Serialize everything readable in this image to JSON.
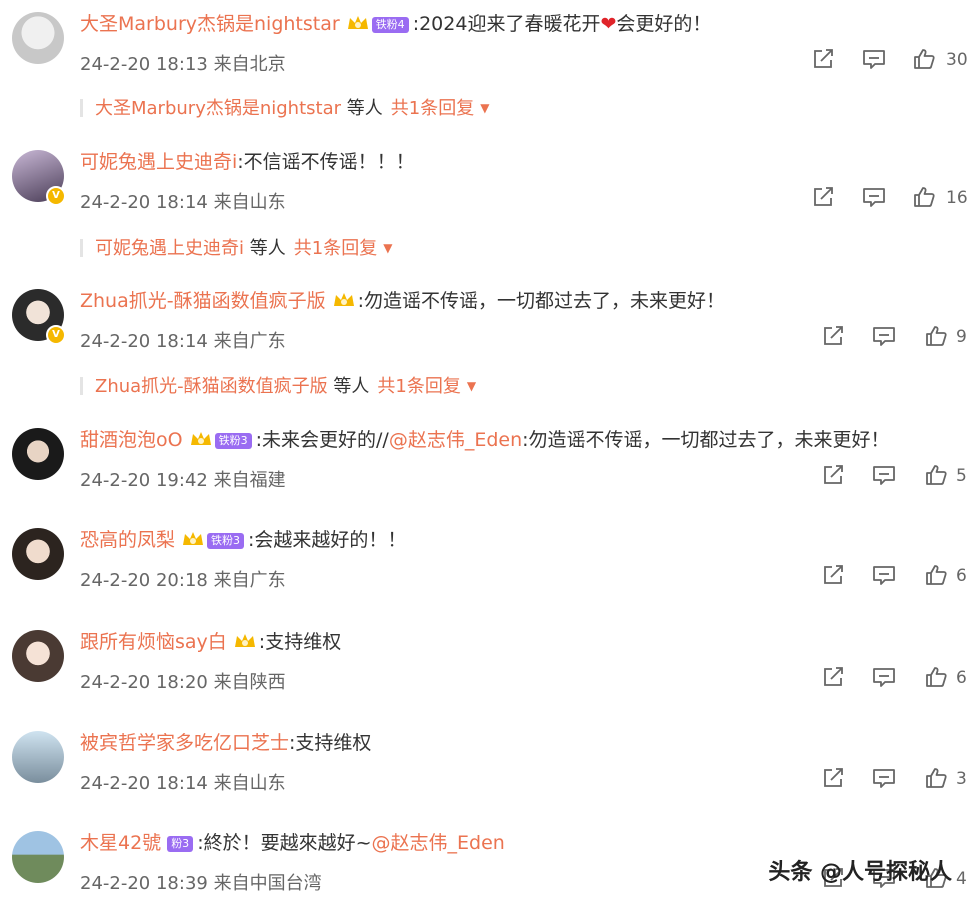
{
  "comments": [
    {
      "user": "大圣Marbury杰锅是nightstar",
      "crown": true,
      "level": "铁粉4",
      "text": ":2024迎来了春暖花开",
      "emoji": "❤",
      "text2": "会更好的！",
      "date": "24-2-20 18:13",
      "location": "来自北京",
      "likes": "30",
      "reply": {
        "user": "大圣Marbury杰锅是nightstar",
        "suffix": "等人",
        "total": "共1条回复"
      }
    },
    {
      "user": "可妮兔遇上史迪奇i",
      "text": ":不信谣不传谣！！！",
      "date": "24-2-20 18:14",
      "location": "来自山东",
      "likes": "16",
      "reply": {
        "user": "可妮兔遇上史迪奇i",
        "suffix": "等人",
        "total": "共1条回复"
      }
    },
    {
      "user": "Zhua抓光-酥猫函数值疯子版",
      "crown": true,
      "text": ":勿造谣不传谣，一切都过去了，未来更好！",
      "date": "24-2-20 18:14",
      "location": "来自广东",
      "likes": "9",
      "reply": {
        "user": "Zhua抓光-酥猫函数值疯子版",
        "suffix": "等人",
        "total": "共1条回复"
      }
    },
    {
      "user": "甜酒泡泡oO",
      "crown": true,
      "level": "铁粉3",
      "text": ":未来会更好的//",
      "mention": "@赵志伟_Eden",
      "text2": ":勿造谣不传谣，一切都过去了，未来更好！",
      "date": "24-2-20 19:42",
      "location": "来自福建",
      "likes": "5"
    },
    {
      "user": "恐高的凤梨",
      "crown": true,
      "level": "铁粉3",
      "text": ":会越来越好的！！",
      "date": "24-2-20 20:18",
      "location": "来自广东",
      "likes": "6"
    },
    {
      "user": "跟所有烦恼say白",
      "crown": true,
      "text": ":支持维权",
      "date": "24-2-20 18:20",
      "location": "来自陕西",
      "likes": "6"
    },
    {
      "user": "被宾哲学家多吃亿口芝士",
      "text": ":支持维权",
      "date": "24-2-20 18:14",
      "location": "来自山东",
      "likes": "3"
    },
    {
      "user": "木星42號",
      "level": "粉3",
      "text": ":終於！要越來越好~",
      "mention": "@赵志伟_Eden",
      "date": "24-2-20 18:39",
      "location": "来自中国台湾",
      "likes": "4"
    }
  ],
  "watermark": "头条 @人号探秘人",
  "icons": {
    "share": "share-icon",
    "comment": "comment-icon",
    "like": "thumbs-up-icon",
    "crown": "crown-icon",
    "verified": "verified-icon",
    "expand": "chevron-down-icon"
  },
  "colors": {
    "username": "#eb7350",
    "level_badge": "#9a6cf2",
    "verified": "#f5b800"
  }
}
